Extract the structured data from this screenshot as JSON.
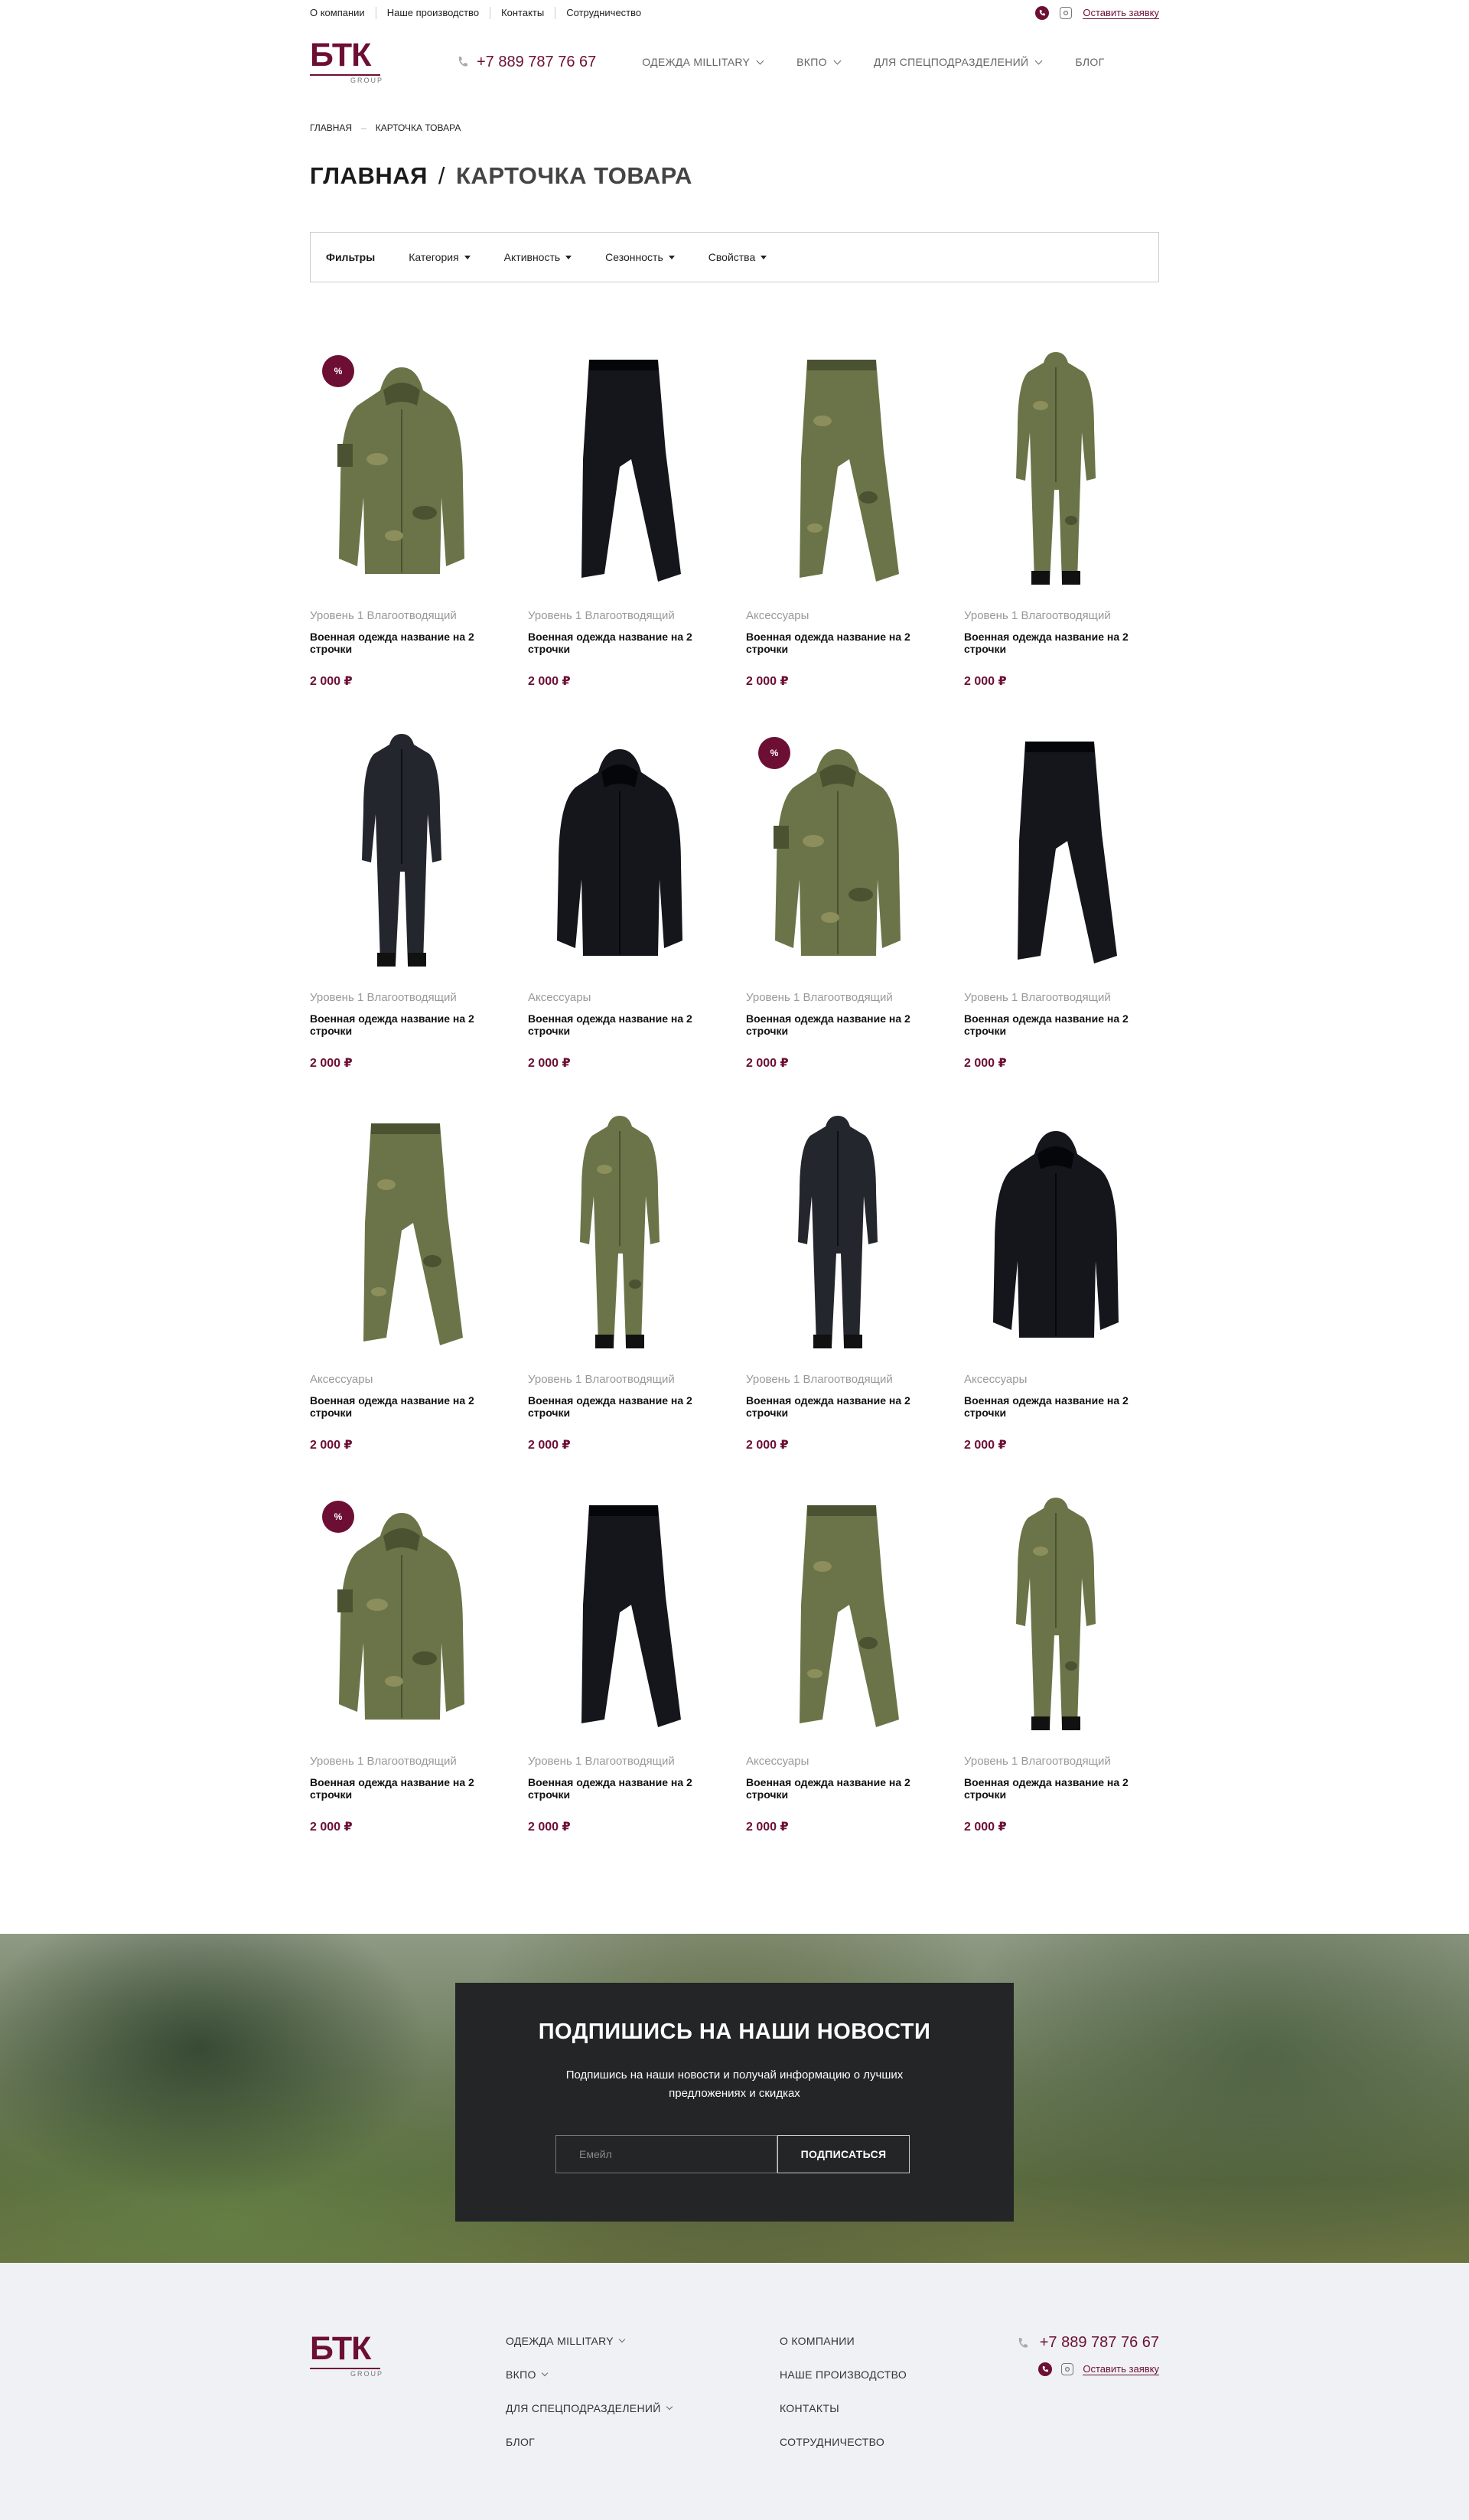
{
  "topbar": {
    "links": [
      "О компании",
      "Наше производство",
      "Контакты",
      "Сотрудничество"
    ],
    "request_label": "Оставить заявку"
  },
  "header": {
    "logo_text": "БТК",
    "logo_sub": "GROUP",
    "phone": "+7 889 787 76 67",
    "nav": [
      "ОДЕЖДА MILLITARY",
      "ВКПО",
      "ДЛЯ СПЕЦПОДРАЗДЕЛЕНИЙ",
      "БЛОГ"
    ]
  },
  "breadcrumb": {
    "home": "ГЛАВНАЯ",
    "sep": "–",
    "current": "КАРТОЧКА ТОВАРА"
  },
  "page_title": {
    "main": "ГЛАВНАЯ",
    "sep": "/",
    "sub": "КАРТОЧКА ТОВАРА"
  },
  "filters": {
    "label": "Фильтры",
    "items": [
      "Категория",
      "Активность",
      "Сезонность",
      "Свойства"
    ]
  },
  "products": [
    {
      "cat": "Уровень 1 Влагоотводящий",
      "name": "Военная одежда название на 2 строчки",
      "price": "2 000 ₽",
      "badge": "%",
      "kind": "jacket-camo"
    },
    {
      "cat": "Уровень 1 Влагоотводящий",
      "name": "Военная одежда название на 2 строчки",
      "price": "2 000 ₽",
      "badge": "",
      "kind": "pants-black"
    },
    {
      "cat": "Аксессуары",
      "name": "Военная одежда название на 2 строчки",
      "price": "2 000 ₽",
      "badge": "",
      "kind": "pants-camo"
    },
    {
      "cat": "Уровень 1 Влагоотводящий",
      "name": "Военная одежда название на 2 строчки",
      "price": "2 000 ₽",
      "badge": "",
      "kind": "suit-camo"
    },
    {
      "cat": "Уровень 1 Влагоотводящий",
      "name": "Военная одежда название на 2 строчки",
      "price": "2 000 ₽",
      "badge": "",
      "kind": "suit-black"
    },
    {
      "cat": "Аксессуары",
      "name": "Военная одежда название на 2 строчки",
      "price": "2 000 ₽",
      "badge": "",
      "kind": "jacket-black"
    },
    {
      "cat": "Уровень 1 Влагоотводящий",
      "name": "Военная одежда название на 2 строчки",
      "price": "2 000 ₽",
      "badge": "%",
      "kind": "jacket-camo"
    },
    {
      "cat": "Уровень 1 Влагоотводящий",
      "name": "Военная одежда название на 2 строчки",
      "price": "2 000 ₽",
      "badge": "",
      "kind": "pants-black"
    },
    {
      "cat": "Аксессуары",
      "name": "Военная одежда название на 2 строчки",
      "price": "2 000 ₽",
      "badge": "",
      "kind": "pants-camo"
    },
    {
      "cat": "Уровень 1 Влагоотводящий",
      "name": "Военная одежда название на 2 строчки",
      "price": "2 000 ₽",
      "badge": "",
      "kind": "suit-camo"
    },
    {
      "cat": "Уровень 1 Влагоотводящий",
      "name": "Военная одежда название на 2 строчки",
      "price": "2 000 ₽",
      "badge": "",
      "kind": "suit-black"
    },
    {
      "cat": "Аксессуары",
      "name": "Военная одежда название на 2 строчки",
      "price": "2 000 ₽",
      "badge": "",
      "kind": "jacket-black"
    },
    {
      "cat": "Уровень 1 Влагоотводящий",
      "name": "Военная одежда название на 2 строчки",
      "price": "2 000 ₽",
      "badge": "%",
      "kind": "jacket-camo"
    },
    {
      "cat": "Уровень 1 Влагоотводящий",
      "name": "Военная одежда название на 2 строчки",
      "price": "2 000 ₽",
      "badge": "",
      "kind": "pants-black"
    },
    {
      "cat": "Аксессуары",
      "name": "Военная одежда название на 2 строчки",
      "price": "2 000 ₽",
      "badge": "",
      "kind": "pants-camo"
    },
    {
      "cat": "Уровень 1 Влагоотводящий",
      "name": "Военная одежда название на 2 строчки",
      "price": "2 000 ₽",
      "badge": "",
      "kind": "suit-camo"
    }
  ],
  "newsletter": {
    "title": "ПОДПИШИСЬ НА НАШИ НОВОСТИ",
    "text": "Подпишись на наши новости и получай информацию о лучших предложениях и скидках",
    "placeholder": "Емейл",
    "button": "ПОДПИСАТЬСЯ"
  },
  "footer": {
    "col1": [
      "ОДЕЖДА MILLITARY",
      "ВКПО",
      "ДЛЯ СПЕЦПОДРАЗДЕЛЕНИЙ",
      "БЛОГ"
    ],
    "col2": [
      "О КОМПАНИИ",
      "НАШЕ ПРОИЗВОДСТВО",
      "КОНТАКТЫ",
      "СОТРУДНИЧЕСТВО"
    ],
    "phone": "+7 889 787 76 67",
    "request_label": "Оставить заявку"
  },
  "colors": {
    "accent": "#6d0f35",
    "dark_box": "#232527",
    "footer_bg": "#eff1f4"
  },
  "icons": [
    "phone-icon",
    "whatsapp-icon",
    "instagram-icon",
    "chevron-down-icon",
    "caret-down-icon"
  ]
}
